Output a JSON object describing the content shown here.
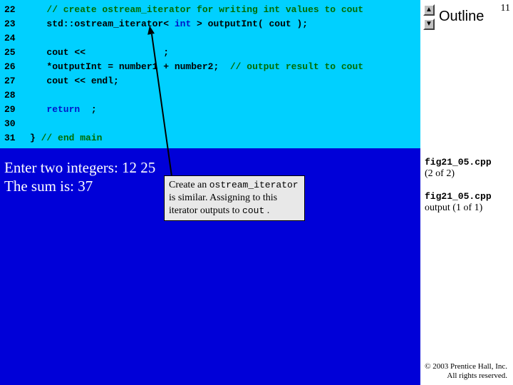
{
  "page_number": "11",
  "outline_title": "Outline",
  "code_lines": [
    {
      "n": "22",
      "frags": [
        {
          "t": "   ",
          "c": "code-text"
        },
        {
          "t": "// create ostream_iterator for writing int values to cout",
          "c": "cm"
        }
      ]
    },
    {
      "n": "23",
      "frags": [
        {
          "t": "   std::ostream_iterator< ",
          "c": "code-text"
        },
        {
          "t": "int",
          "c": "kw"
        },
        {
          "t": " > outputInt( cout );",
          "c": "code-text"
        }
      ]
    },
    {
      "n": "24",
      "frags": [
        {
          "t": "",
          "c": "code-text"
        }
      ]
    },
    {
      "n": "25",
      "frags": [
        {
          "t": "   cout <<              ;",
          "c": "code-text"
        }
      ]
    },
    {
      "n": "26",
      "frags": [
        {
          "t": "   *outputInt = number1 + number2;  ",
          "c": "code-text"
        },
        {
          "t": "// output result to cout",
          "c": "cm"
        }
      ]
    },
    {
      "n": "27",
      "frags": [
        {
          "t": "   cout << endl;",
          "c": "code-text"
        }
      ]
    },
    {
      "n": "28",
      "frags": [
        {
          "t": "",
          "c": "code-text"
        }
      ]
    },
    {
      "n": "29",
      "frags": [
        {
          "t": "   ",
          "c": "code-text"
        },
        {
          "t": "return",
          "c": "kw"
        },
        {
          "t": "  ;",
          "c": "code-text"
        }
      ]
    },
    {
      "n": "30",
      "frags": [
        {
          "t": "",
          "c": "code-text"
        }
      ]
    },
    {
      "n": "31",
      "frags": [
        {
          "t": "} ",
          "c": "code-text"
        },
        {
          "t": "// end main",
          "c": "cm"
        }
      ]
    }
  ],
  "output_lines": [
    "Enter two integers: 12 25",
    "The sum is: 37"
  ],
  "side_labels": {
    "l1a": "fig21_05.cpp",
    "l1b": "(2 of 2)",
    "l2a": "fig21_05.cpp",
    "l2b": "output (1 of 1)"
  },
  "callout": {
    "t1": "Create an ",
    "m1": "ostream_iterator",
    "t2": " is similar. Assigning to this iterator outputs to ",
    "m2": "cout",
    "t3": "."
  },
  "copyright": {
    "l1": "© 2003 Prentice Hall, Inc.",
    "l2": "All rights reserved."
  },
  "arrows": {
    "up": "▲",
    "down": "▼"
  }
}
